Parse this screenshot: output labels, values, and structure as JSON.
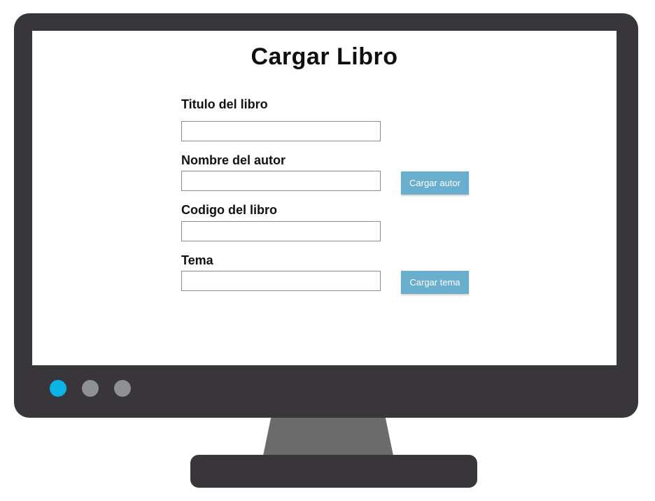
{
  "form": {
    "title": "Cargar Libro",
    "fields": [
      {
        "label": "Titulo del libro",
        "value": ""
      },
      {
        "label": "Nombre del autor",
        "value": ""
      },
      {
        "label": "Codigo del libro",
        "value": ""
      },
      {
        "label": "Tema",
        "value": ""
      }
    ],
    "buttons": {
      "load_author": "Cargar autor",
      "load_topic": "Cargar tema"
    }
  },
  "monitor": {
    "indicators": [
      {
        "name": "active",
        "color": "#0ab4e6"
      },
      {
        "name": "inactive",
        "color": "#8d9191"
      },
      {
        "name": "inactive",
        "color": "#8d9191"
      }
    ],
    "frame_color": "#38363b",
    "accent_button_color": "#6aaecd"
  }
}
